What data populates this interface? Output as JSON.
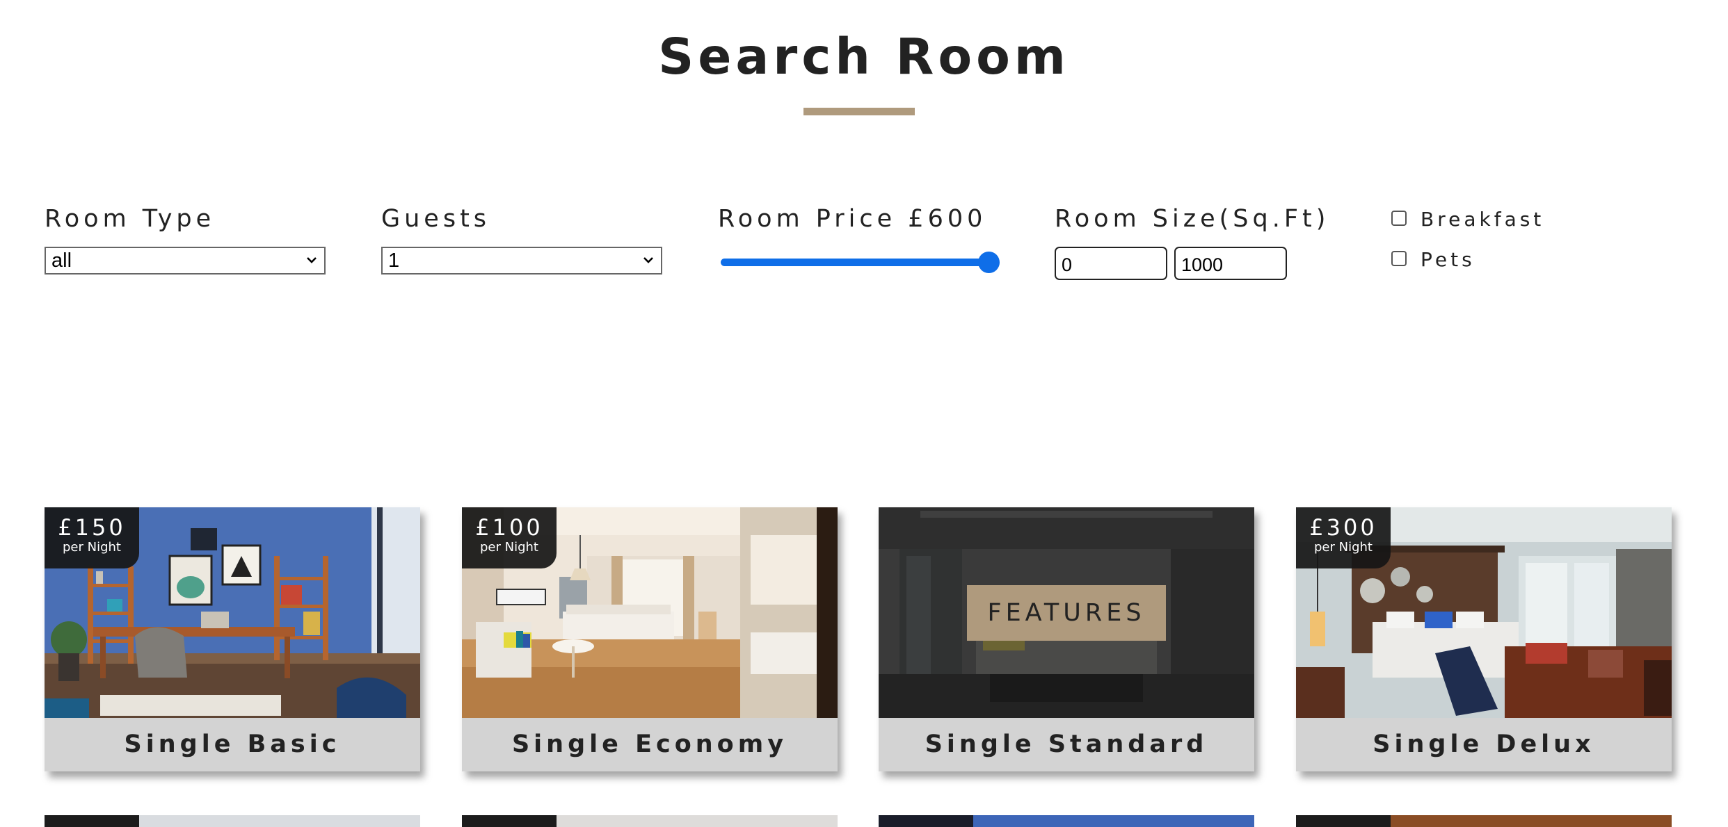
{
  "page": {
    "title": "Search Room"
  },
  "filters": {
    "room_type": {
      "label": "Room Type",
      "value": "all"
    },
    "guests": {
      "label": "Guests",
      "value": "1"
    },
    "room_price": {
      "label": "Room Price £600",
      "value": 600,
      "fill_fraction": 1.0
    },
    "room_size": {
      "label": "Room Size(Sq.Ft)",
      "min_value": "0",
      "max_value": "1000"
    },
    "breakfast": {
      "label": "Breakfast",
      "checked": false
    },
    "pets": {
      "label": "Pets",
      "checked": false
    }
  },
  "rooms": [
    {
      "name": "Single Basic",
      "price": "£150",
      "unit": "per Night",
      "image": "blue-study-room-photo"
    },
    {
      "name": "Single Economy",
      "price": "£100",
      "unit": "per Night",
      "image": "bright-bedroom-photo"
    },
    {
      "name": "Single Standard",
      "price": "",
      "unit": "",
      "hover_label": "FEATURES",
      "image": "dark-bedroom-photo"
    },
    {
      "name": "Single Delux",
      "price": "£300",
      "unit": "per Night",
      "image": "hotel-suite-photo"
    }
  ],
  "colors": {
    "accent": "#af9a7d",
    "slider": "#0f6ee8",
    "card_footer": "#d3d3d3",
    "badge": "#161616"
  },
  "icons": {
    "select_arrow": "chevron-down-icon"
  }
}
